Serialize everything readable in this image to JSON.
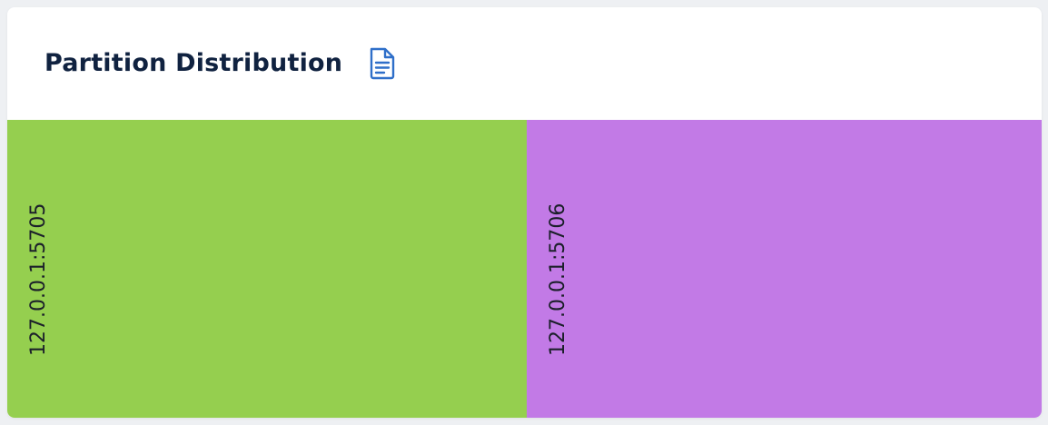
{
  "card": {
    "title": "Partition Distribution",
    "title_icon": "document-icon"
  },
  "distribution": {
    "segments": [
      {
        "label": "127.0.0.1:5705",
        "color": "#95cf4f",
        "fraction": 0.502
      },
      {
        "label": "127.0.0.1:5706",
        "color": "#c27ae6",
        "fraction": 0.498
      }
    ]
  }
}
